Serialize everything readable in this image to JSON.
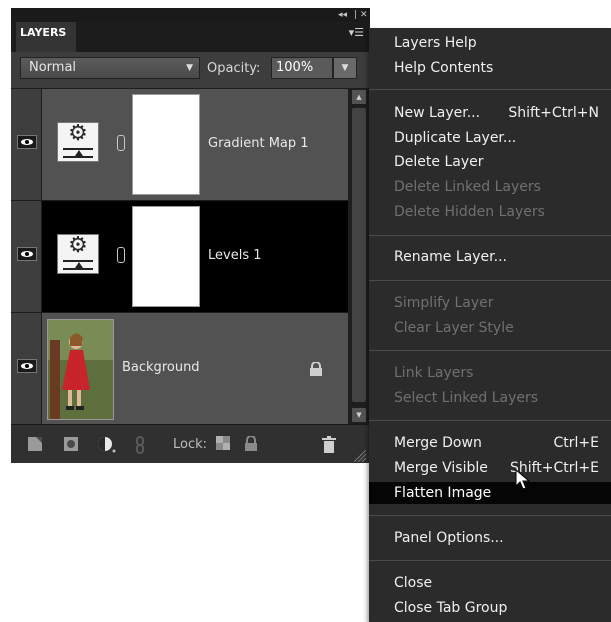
{
  "panel": {
    "title": "LAYERS",
    "collapse_icon": "double-chevron-icon",
    "close_icon": "close-icon",
    "menu_icon": "panel-menu-icon",
    "blend_mode": "Normal",
    "opacity_label": "Opacity:",
    "opacity_value": "100%",
    "layers": [
      {
        "name": "Gradient Map 1",
        "type": "adjustment",
        "selected": false,
        "visible": true
      },
      {
        "name": "Levels 1",
        "type": "adjustment",
        "selected": true,
        "visible": true
      },
      {
        "name": "Background",
        "type": "image",
        "selected": false,
        "visible": true,
        "locked": true
      }
    ],
    "lock_label": "Lock:",
    "bottom_tools": [
      "new-layer-icon",
      "layer-mask-icon",
      "adjustment-layer-icon",
      "link-icon",
      "lock-transparency-icon",
      "lock-all-icon",
      "trash-icon"
    ]
  },
  "menu": {
    "items": [
      {
        "label": "Layers Help",
        "shortcut": "",
        "disabled": false
      },
      {
        "label": "Help Contents",
        "shortcut": "",
        "disabled": false
      },
      {
        "label": "New Layer...",
        "shortcut": "Shift+Ctrl+N",
        "disabled": false
      },
      {
        "label": "Duplicate Layer...",
        "shortcut": "",
        "disabled": false
      },
      {
        "label": "Delete Layer",
        "shortcut": "",
        "disabled": false
      },
      {
        "label": "Delete Linked Layers",
        "shortcut": "",
        "disabled": true
      },
      {
        "label": "Delete Hidden Layers",
        "shortcut": "",
        "disabled": true
      },
      {
        "label": "Rename Layer...",
        "shortcut": "",
        "disabled": false
      },
      {
        "label": "Simplify Layer",
        "shortcut": "",
        "disabled": true
      },
      {
        "label": "Clear Layer Style",
        "shortcut": "",
        "disabled": true
      },
      {
        "label": "Link Layers",
        "shortcut": "",
        "disabled": true
      },
      {
        "label": "Select Linked Layers",
        "shortcut": "",
        "disabled": true
      },
      {
        "label": "Merge Down",
        "shortcut": "Ctrl+E",
        "disabled": false
      },
      {
        "label": "Merge Visible",
        "shortcut": "Shift+Ctrl+E",
        "disabled": false
      },
      {
        "label": "Flatten Image",
        "shortcut": "",
        "disabled": false,
        "highlighted": true
      },
      {
        "label": "Panel Options...",
        "shortcut": "",
        "disabled": false
      },
      {
        "label": "Close",
        "shortcut": "",
        "disabled": false
      },
      {
        "label": "Close Tab Group",
        "shortcut": "",
        "disabled": false
      }
    ]
  },
  "colors": {
    "panel_bg": "#525252",
    "selected_row": "#000000",
    "menu_bg": "#2b2b2b",
    "menu_text": "#f0f0f0",
    "menu_disabled": "#707070"
  }
}
